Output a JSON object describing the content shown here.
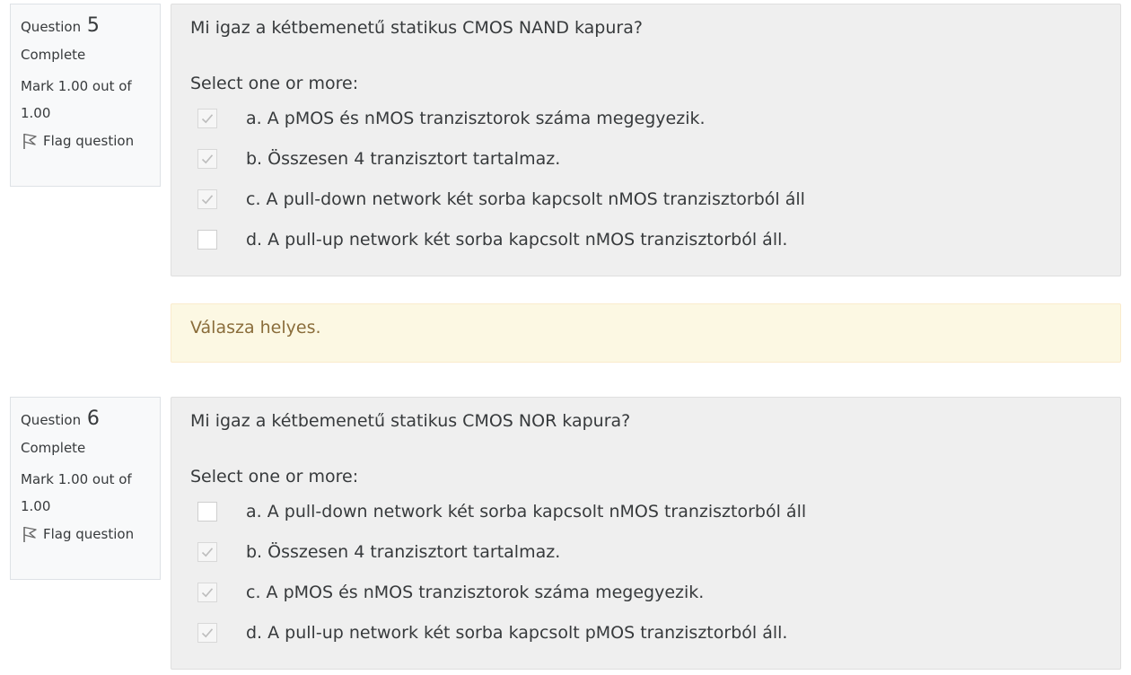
{
  "questions": [
    {
      "label": "Question",
      "number": "5",
      "state": "Complete",
      "grade": "Mark 1.00 out of 1.00",
      "flag_label": "Flag question",
      "text": "Mi igaz a kétbemenetű statikus CMOS NAND kapura?",
      "prompt": "Select one or more:",
      "options": [
        {
          "label": "a. A pMOS és nMOS tranzisztorok száma megegyezik.",
          "checked": true
        },
        {
          "label": "b. Összesen 4 tranzisztort tartalmaz.",
          "checked": true
        },
        {
          "label": "c. A pull-down network két sorba kapcsolt nMOS tranzisztorból áll",
          "checked": true
        },
        {
          "label": "d. A pull-up network két sorba kapcsolt nMOS tranzisztorból áll.",
          "checked": false
        }
      ],
      "feedback": "Válasza helyes."
    },
    {
      "label": "Question",
      "number": "6",
      "state": "Complete",
      "grade": "Mark 1.00 out of 1.00",
      "flag_label": "Flag question",
      "text": "Mi igaz a kétbemenetű statikus CMOS NOR kapura?",
      "prompt": "Select one or more:",
      "options": [
        {
          "label": "a. A pull-down network két sorba kapcsolt nMOS tranzisztorból áll",
          "checked": false
        },
        {
          "label": "b. Összesen 4 tranzisztort tartalmaz.",
          "checked": true
        },
        {
          "label": "c. A pMOS és nMOS tranzisztorok száma megegyezik.",
          "checked": true
        },
        {
          "label": "d. A pull-up network két sorba kapcsolt pMOS tranzisztorból áll.",
          "checked": true
        }
      ]
    }
  ],
  "colors": {
    "info_bg": "#f8f9fa",
    "content_bg": "#efefef",
    "feedback_bg": "#fcf8e3",
    "feedback_text": "#8a6d3b",
    "check_mark": "#bdbdbd"
  },
  "icons": {
    "flag": "flag-icon",
    "check": "check-icon"
  }
}
